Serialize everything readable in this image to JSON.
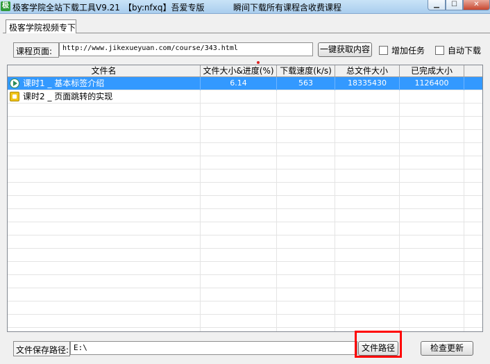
{
  "window": {
    "icon_glyph": "极",
    "title": "极客学院全站下载工具V9.21",
    "title_author": "【by:nfxq】吾爱专版",
    "title_slogan": "瞬间下载所有课程含收费课程",
    "min_glyph": "▁",
    "max_glyph": "☐",
    "close_glyph": "✕"
  },
  "tab": {
    "label": "极客学院视频专下"
  },
  "course": {
    "label": "课程页面:",
    "url": "http://www.jikexueyuan.com/course/343.html",
    "fetch_button": "一键获取内容",
    "add_task_label": "增加任务",
    "auto_download_label": "自动下载"
  },
  "table": {
    "columns": [
      "文件名",
      "文件大小&进度(%)",
      "下载速度(k/s)",
      "总文件大小",
      "已完成大小"
    ],
    "rows": [
      {
        "name": "课时1 _ 基本标签介绍",
        "progress": "6.14",
        "speed": "563",
        "total": "18335430",
        "done": "1126400",
        "icon": "play-icon",
        "selected": true
      },
      {
        "name": "课时2 _ 页面跳转的实现",
        "progress": "",
        "speed": "",
        "total": "",
        "done": "",
        "icon": "pause-icon",
        "selected": false
      }
    ]
  },
  "save": {
    "label": "文件保存路径:",
    "path": "E:\\",
    "path_button": "文件路径",
    "update_button": "检查更新"
  },
  "colors": {
    "selection": "#3399ff",
    "highlight": "#ff0000",
    "title_bar": "#b9d7f2"
  }
}
